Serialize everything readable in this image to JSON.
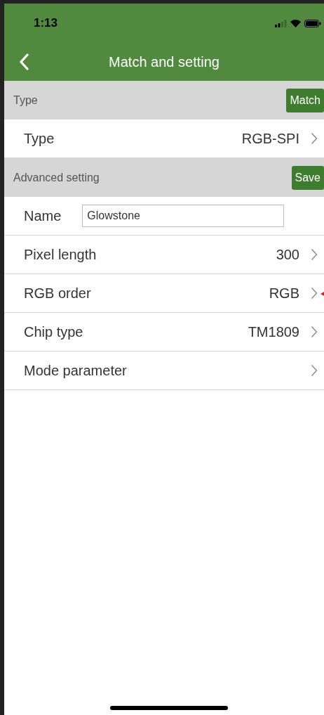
{
  "status_bar": {
    "time": "1:13"
  },
  "nav_bar": {
    "title": "Match and setting"
  },
  "sections": [
    {
      "title": "Type",
      "button": "Match",
      "rows": [
        {
          "kind": "link",
          "label": "Type",
          "value": "RGB-SPI",
          "marked": false
        }
      ]
    },
    {
      "title": "Advanced setting",
      "button": "Save",
      "rows": [
        {
          "kind": "input",
          "label": "Name",
          "value": "Glowstone"
        },
        {
          "kind": "link",
          "label": "Pixel length",
          "value": "300",
          "marked": false
        },
        {
          "kind": "link",
          "label": "RGB order",
          "value": "RGB",
          "marked": true
        },
        {
          "kind": "link",
          "label": "Chip type",
          "value": "TM1809",
          "marked": false
        },
        {
          "kind": "link",
          "label": "Mode parameter",
          "marked": false
        }
      ]
    }
  ]
}
